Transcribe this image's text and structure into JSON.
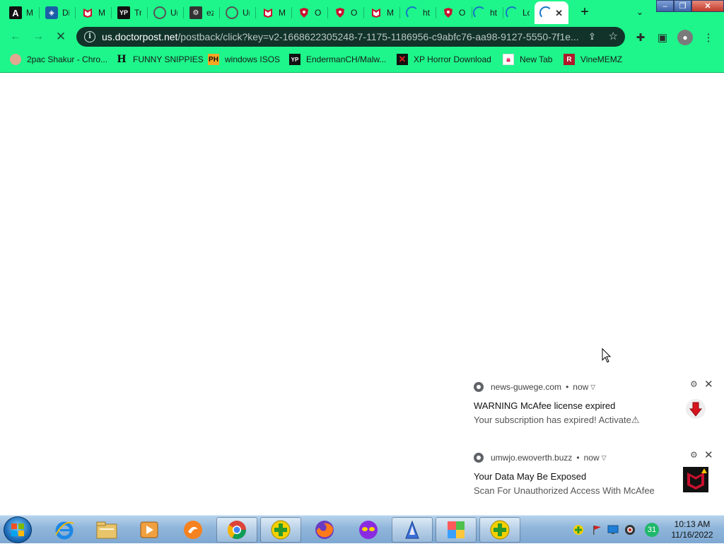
{
  "window": {
    "tabs": [
      {
        "title": "M",
        "icon": "a-icon"
      },
      {
        "title": "Di",
        "icon": "d-icon"
      },
      {
        "title": "M",
        "icon": "mcafee-icon"
      },
      {
        "title": "Tr",
        "icon": "yp-icon"
      },
      {
        "title": "Ur",
        "icon": "globe-icon"
      },
      {
        "title": "ez",
        "icon": "gear-icon"
      },
      {
        "title": "Ur",
        "icon": "globe-icon"
      },
      {
        "title": "M",
        "icon": "mcafee-icon"
      },
      {
        "title": "O",
        "icon": "shield-icon"
      },
      {
        "title": "O",
        "icon": "shield-icon"
      },
      {
        "title": "M",
        "icon": "mcafee-icon"
      },
      {
        "title": "ht",
        "icon": "loading-icon"
      },
      {
        "title": "O",
        "icon": "shield-icon"
      },
      {
        "title": "ht",
        "icon": "loading-icon"
      },
      {
        "title": "Lo",
        "icon": "loading-icon"
      }
    ],
    "active_tab_close": "✕",
    "new_tab": "+",
    "controls": {
      "minimize": "–",
      "maximize": "❐",
      "close": "✕"
    }
  },
  "toolbar": {
    "url_host": "us.doctorpost.net",
    "url_path": "/postback/click?key=v2-1668622305248-7-1175-1186956-c9abfc76-aa98-9127-5550-7f1e..."
  },
  "bookmarks": [
    {
      "label": "2pac Shakur - Chro...",
      "icon": "profile-icon"
    },
    {
      "label": "FUNNY SNIPPIES",
      "icon": "h-icon"
    },
    {
      "label": "windows ISOS",
      "icon": "ph-icon"
    },
    {
      "label": "EndermanCH/Malw...",
      "icon": "yp-icon"
    },
    {
      "label": "XP Horror Download",
      "icon": "x-icon"
    },
    {
      "label": "New Tab",
      "icon": "lock-icon"
    },
    {
      "label": "VineMEMZ",
      "icon": "r-icon"
    }
  ],
  "notifications": [
    {
      "source": "news-guwege.com",
      "time": "now",
      "title": "WARNING McAfee license expired",
      "body": " Your subscription has expired! Activate⚠"
    },
    {
      "source": "umwjo.ewoverth.buzz",
      "time": "now",
      "title": "Your Data May Be Exposed",
      "body": "Scan For Unauthorized Access With McAfee"
    }
  ],
  "taskbar": {
    "tray_badge": "31",
    "time": "10:13 AM",
    "date": "11/16/2022"
  },
  "colors": {
    "theme": "#1ef58a",
    "omnibox": "#11332a",
    "mcafee_red": "#c8102e"
  }
}
